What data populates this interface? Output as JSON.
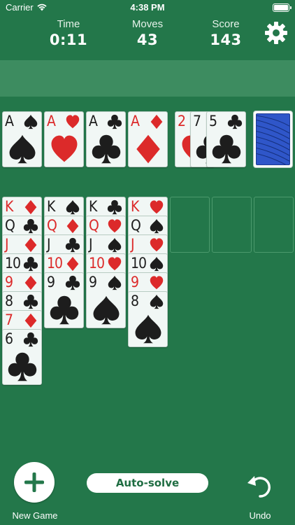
{
  "status_bar": {
    "carrier": "Carrier",
    "time": "4:38 PM"
  },
  "stats": {
    "time_label": "Time",
    "time_value": "0:11",
    "moves_label": "Moves",
    "moves_value": "43",
    "score_label": "Score",
    "score_value": "143"
  },
  "colors": {
    "felt": "#23774a",
    "banner": "#3d8c60",
    "red_suit": "#dc2a2a",
    "black_suit": "#1d1d1d",
    "card_back": "#2f56c9"
  },
  "foundations": [
    {
      "rank": "A",
      "suit": "spade"
    },
    {
      "rank": "A",
      "suit": "heart"
    },
    {
      "rank": "A",
      "suit": "club"
    },
    {
      "rank": "A",
      "suit": "diamond"
    }
  ],
  "waste": [
    {
      "rank": "2",
      "suit": "heart"
    },
    {
      "rank": "7",
      "suit": "club"
    },
    {
      "rank": "5",
      "suit": "club"
    }
  ],
  "stock": {
    "icon": "card-back-icon"
  },
  "tableau": [
    [
      {
        "rank": "K",
        "suit": "diamond"
      },
      {
        "rank": "Q",
        "suit": "club"
      },
      {
        "rank": "J",
        "suit": "diamond"
      },
      {
        "rank": "10",
        "suit": "club"
      },
      {
        "rank": "9",
        "suit": "diamond"
      },
      {
        "rank": "8",
        "suit": "club"
      },
      {
        "rank": "7",
        "suit": "diamond"
      },
      {
        "rank": "6",
        "suit": "club"
      }
    ],
    [
      {
        "rank": "K",
        "suit": "spade"
      },
      {
        "rank": "Q",
        "suit": "diamond"
      },
      {
        "rank": "J",
        "suit": "club"
      },
      {
        "rank": "10",
        "suit": "diamond"
      },
      {
        "rank": "9",
        "suit": "club"
      }
    ],
    [
      {
        "rank": "K",
        "suit": "club"
      },
      {
        "rank": "Q",
        "suit": "heart"
      },
      {
        "rank": "J",
        "suit": "spade"
      },
      {
        "rank": "10",
        "suit": "heart"
      },
      {
        "rank": "9",
        "suit": "spade"
      }
    ],
    [
      {
        "rank": "K",
        "suit": "heart"
      },
      {
        "rank": "Q",
        "suit": "spade"
      },
      {
        "rank": "J",
        "suit": "heart"
      },
      {
        "rank": "10",
        "suit": "spade"
      },
      {
        "rank": "9",
        "suit": "heart"
      },
      {
        "rank": "8",
        "suit": "spade"
      }
    ],
    [],
    [],
    []
  ],
  "toolbar": {
    "new_game_label": "New Game",
    "auto_solve_label": "Auto-solve",
    "undo_label": "Undo"
  }
}
